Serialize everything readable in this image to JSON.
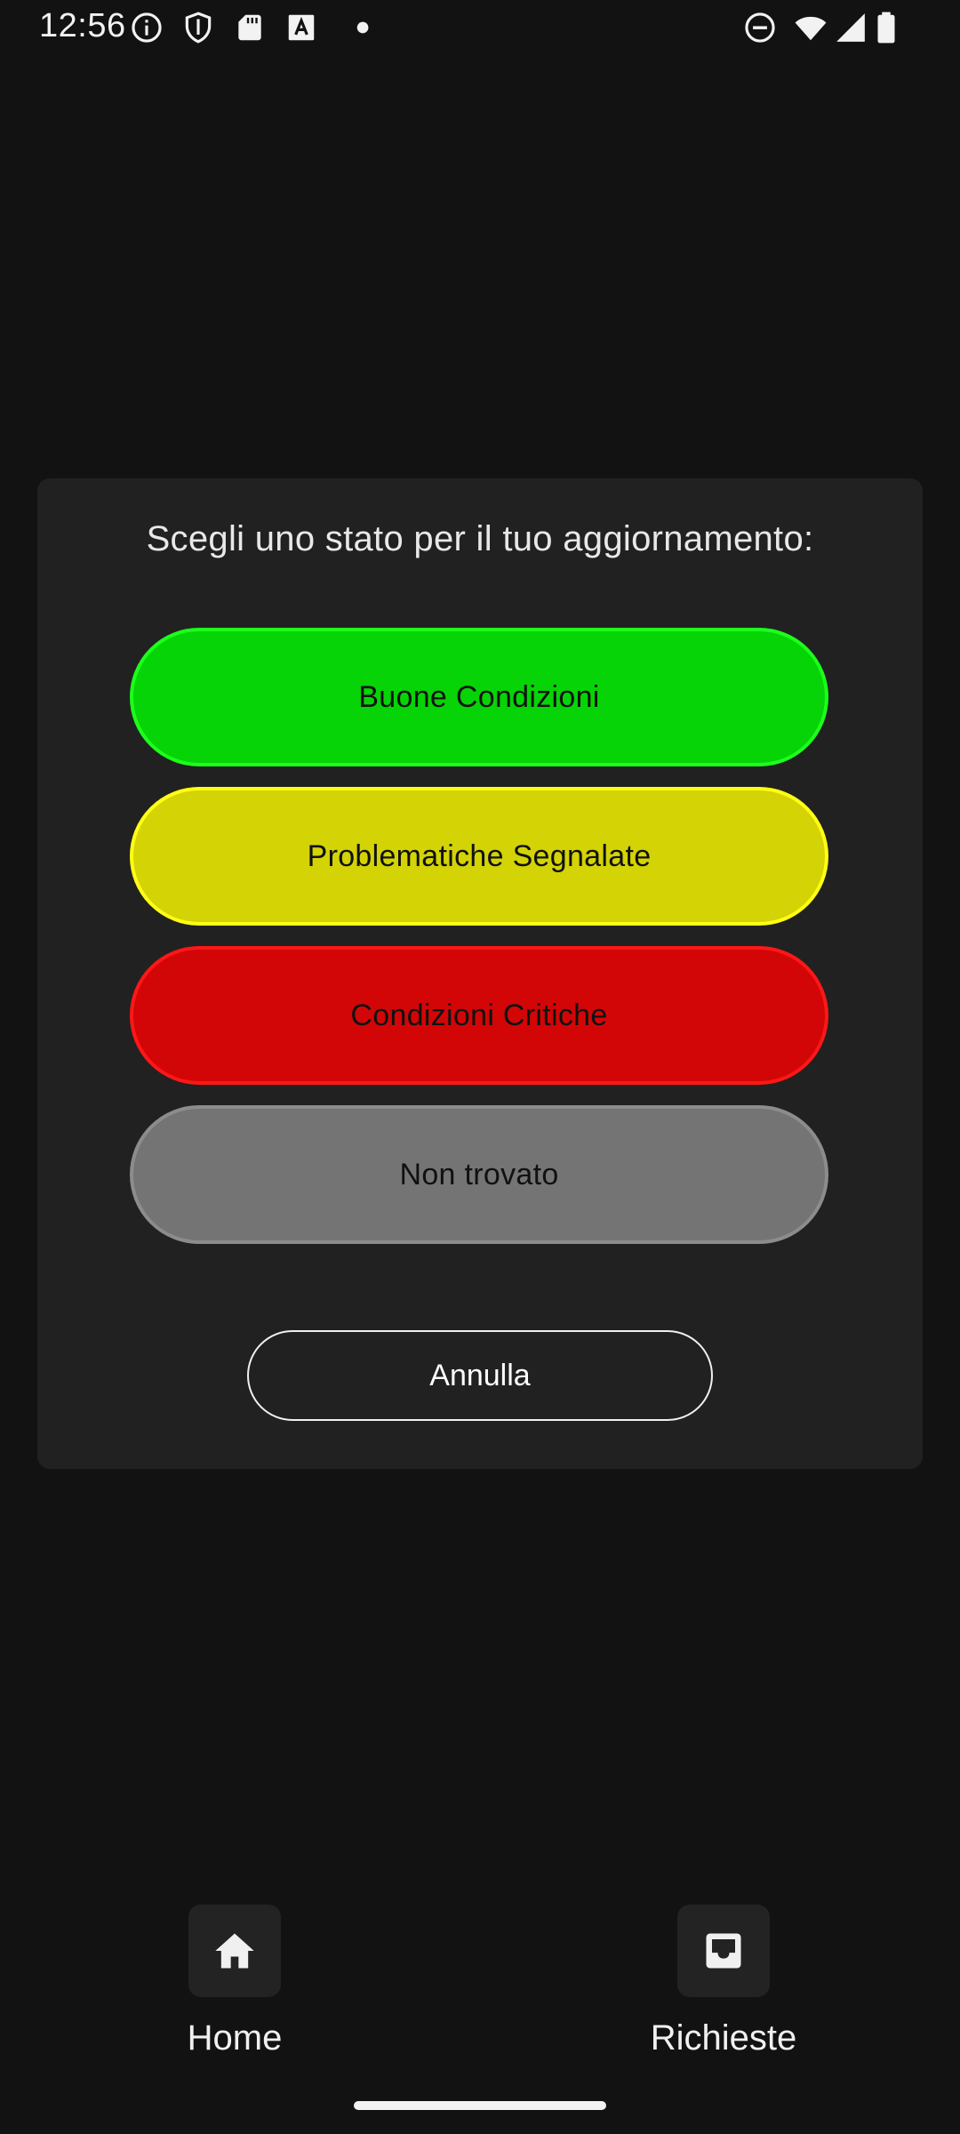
{
  "status_bar": {
    "time": "12:56",
    "left_icons": [
      "info-icon",
      "shield-icon",
      "sd-card-icon",
      "font-a-icon",
      "dot-icon"
    ],
    "right_icons": [
      "do-not-disturb-icon",
      "wifi-icon",
      "signal-icon",
      "battery-icon"
    ]
  },
  "dialog": {
    "title": "Scegli uno stato per il tuo aggiornamento:",
    "options": [
      {
        "label": "Buone Condizioni",
        "color": "#06d406"
      },
      {
        "label": "Problematiche Segnalate",
        "color": "#d3d306"
      },
      {
        "label": "Condizioni Critiche",
        "color": "#d20606"
      },
      {
        "label": "Non trovato",
        "color": "#747474"
      }
    ],
    "cancel_label": "Annulla"
  },
  "bottom_nav": {
    "items": [
      {
        "label": "Home",
        "icon": "home-icon"
      },
      {
        "label": "Richieste",
        "icon": "inbox-icon"
      }
    ]
  }
}
